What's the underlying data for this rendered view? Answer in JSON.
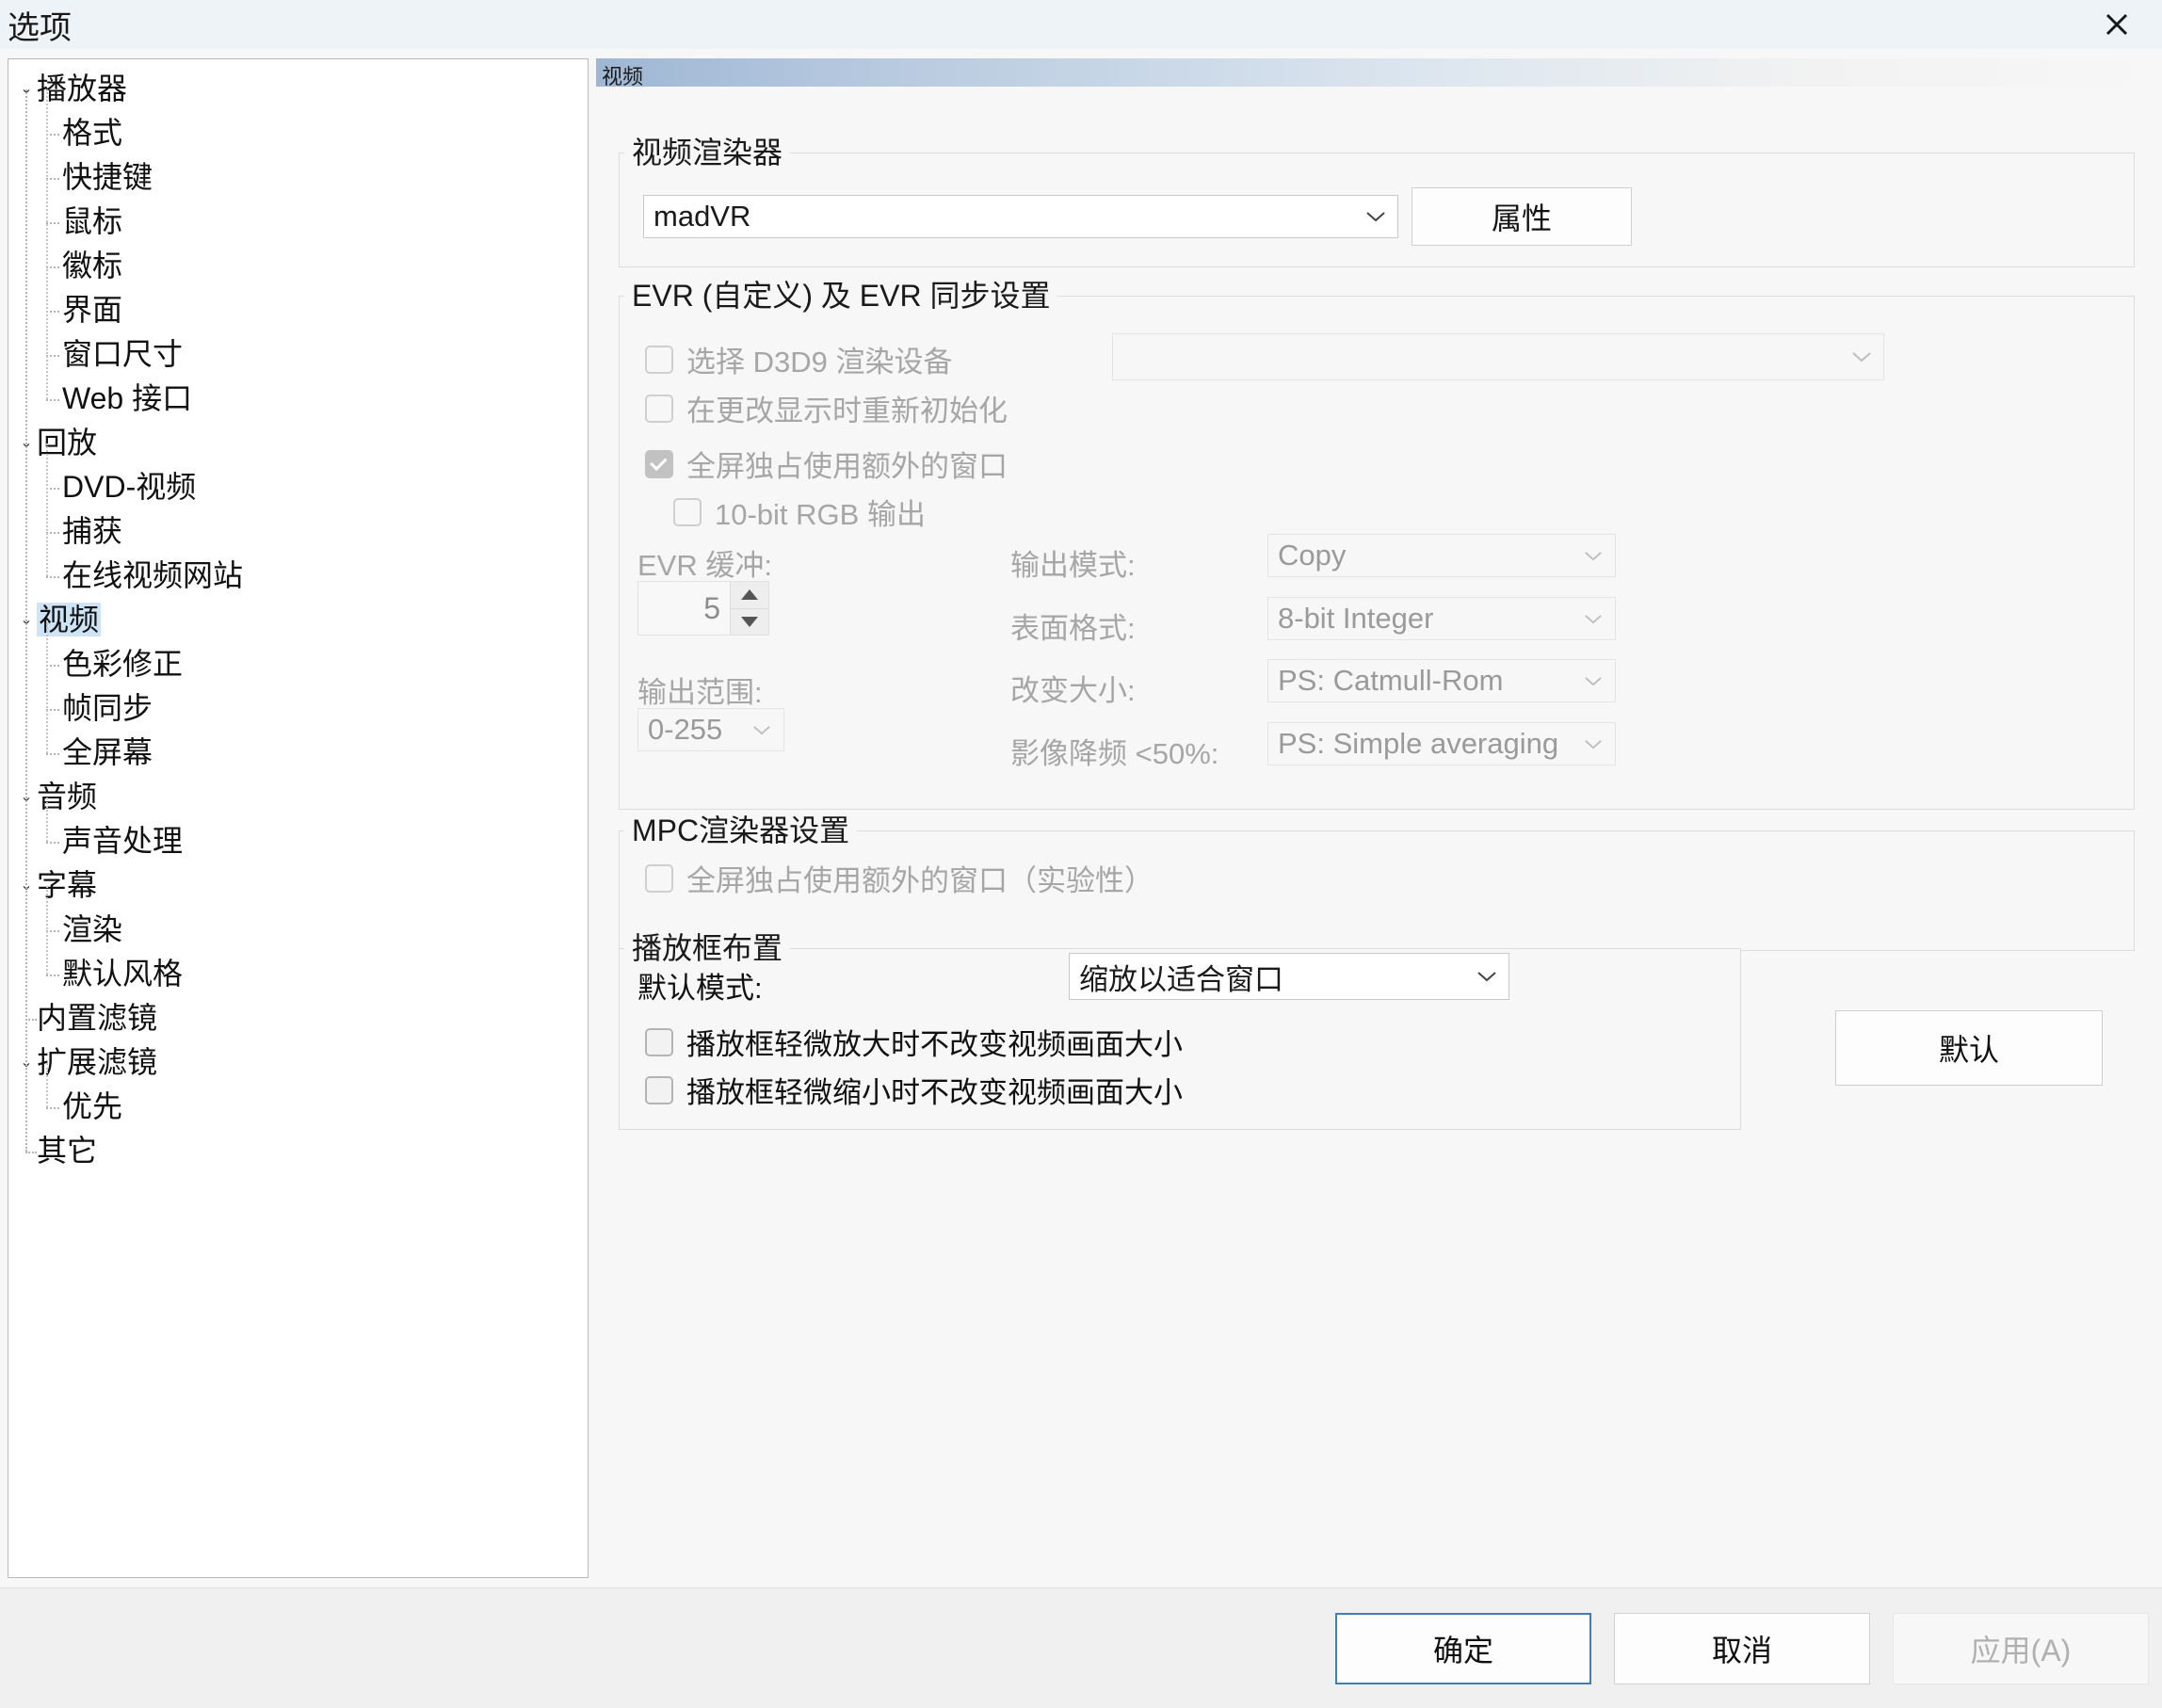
{
  "window": {
    "title": "选项",
    "close_icon": "close-icon"
  },
  "tree": {
    "items": [
      {
        "label": "播放器",
        "level": 0,
        "expandable": true,
        "selected": false
      },
      {
        "label": "格式",
        "level": 1,
        "expandable": false,
        "selected": false
      },
      {
        "label": "快捷键",
        "level": 1,
        "expandable": false,
        "selected": false
      },
      {
        "label": "鼠标",
        "level": 1,
        "expandable": false,
        "selected": false
      },
      {
        "label": "徽标",
        "level": 1,
        "expandable": false,
        "selected": false
      },
      {
        "label": "界面",
        "level": 1,
        "expandable": false,
        "selected": false
      },
      {
        "label": "窗口尺寸",
        "level": 1,
        "expandable": false,
        "selected": false
      },
      {
        "label": "Web 接口",
        "level": 1,
        "expandable": false,
        "selected": false
      },
      {
        "label": "回放",
        "level": 0,
        "expandable": true,
        "selected": false
      },
      {
        "label": "DVD-视频",
        "level": 1,
        "expandable": false,
        "selected": false
      },
      {
        "label": "捕获",
        "level": 1,
        "expandable": false,
        "selected": false
      },
      {
        "label": "在线视频网站",
        "level": 1,
        "expandable": false,
        "selected": false
      },
      {
        "label": "视频",
        "level": 0,
        "expandable": true,
        "selected": true
      },
      {
        "label": "色彩修正",
        "level": 1,
        "expandable": false,
        "selected": false
      },
      {
        "label": "帧同步",
        "level": 1,
        "expandable": false,
        "selected": false
      },
      {
        "label": "全屏幕",
        "level": 1,
        "expandable": false,
        "selected": false
      },
      {
        "label": "音频",
        "level": 0,
        "expandable": true,
        "selected": false
      },
      {
        "label": "声音处理",
        "level": 1,
        "expandable": false,
        "selected": false
      },
      {
        "label": "字幕",
        "level": 0,
        "expandable": true,
        "selected": false
      },
      {
        "label": "渲染",
        "level": 1,
        "expandable": false,
        "selected": false
      },
      {
        "label": "默认风格",
        "level": 1,
        "expandable": false,
        "selected": false
      },
      {
        "label": "内置滤镜",
        "level": 0,
        "expandable": false,
        "selected": false
      },
      {
        "label": "扩展滤镜",
        "level": 0,
        "expandable": true,
        "selected": false
      },
      {
        "label": "优先",
        "level": 1,
        "expandable": false,
        "selected": false
      },
      {
        "label": "其它",
        "level": 0,
        "expandable": false,
        "selected": false
      }
    ],
    "expand_glyph": "⌄"
  },
  "pane": {
    "header_title": "视频",
    "renderer_group": {
      "title": "视频渲染器",
      "renderer_value": "madVR",
      "properties_button": "属性"
    },
    "evr_group": {
      "title": "EVR (自定义) 及 EVR 同步设置",
      "cb_d3d9": "选择 D3D9 渲染设备",
      "cb_reinit": "在更改显示时重新初始化",
      "cb_fullscreen_extra": "全屏独占使用额外的窗口",
      "cb_10bit": "10-bit RGB 输出",
      "d3d9_device_value": "",
      "evr_buffer_label": "EVR 缓冲:",
      "evr_buffer_value": "5",
      "output_range_label": "输出范围:",
      "output_range_value": "0-255",
      "output_mode_label": "输出模式:",
      "output_mode_value": "Copy",
      "surface_format_label": "表面格式:",
      "surface_format_value": "8-bit Integer",
      "resize_label": "改变大小:",
      "resize_value": "PS: Catmull-Rom",
      "downscale_label": "影像降频 <50%:",
      "downscale_value": "PS: Simple averaging"
    },
    "mpc_group": {
      "title": "MPC渲染器设置",
      "cb_fullscreen_extra_exp": "全屏独占使用额外的窗口（实验性）"
    },
    "layout_group": {
      "title": "播放框布置",
      "default_mode_label": "默认模式:",
      "default_mode_value": "缩放以适合窗口",
      "cb_no_resize_up": "播放框轻微放大时不改变视频画面大小",
      "cb_no_resize_down": "播放框轻微缩小时不改变视频画面大小"
    },
    "defaults_button": "默认"
  },
  "footer": {
    "ok": "确定",
    "cancel": "取消",
    "apply": "应用(A)"
  },
  "colors": {
    "titlebar_bg": "#eef3f7",
    "selection_bg": "#cde4f7",
    "focus_border": "#3e7fb5",
    "pane_bg": "#f7f7f7",
    "header_gradient_start": "#9fb7d4"
  }
}
